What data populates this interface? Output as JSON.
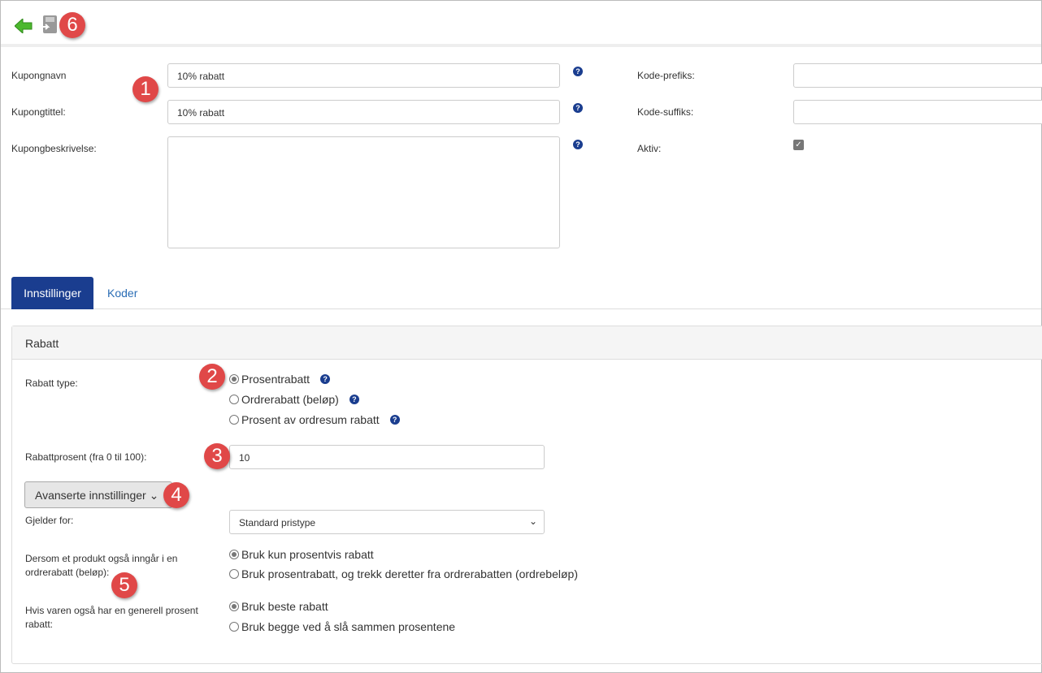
{
  "toolbar": {
    "back_icon": "green-arrow-left-icon",
    "save_icon": "save-disk-icon"
  },
  "badges": [
    "1",
    "2",
    "3",
    "4",
    "5",
    "6"
  ],
  "form": {
    "name_label": "Kupongnavn",
    "name_value": "10% rabatt",
    "title_label": "Kupongtittel:",
    "title_value": "10% rabatt",
    "desc_label": "Kupongbeskrivelse:",
    "desc_value": "",
    "prefix_label": "Kode-prefiks:",
    "prefix_value": "",
    "suffix_label": "Kode-suffiks:",
    "suffix_value": "",
    "active_label": "Aktiv:",
    "active_checked": true,
    "help": "?"
  },
  "tabs": [
    {
      "label": "Innstillinger",
      "active": true
    },
    {
      "label": "Koder",
      "active": false
    }
  ],
  "panel": {
    "title": "Rabatt",
    "type_label": "Rabatt type:",
    "type_options": [
      {
        "label": "Prosentrabatt",
        "checked": true
      },
      {
        "label": "Ordrerabatt (beløp)",
        "checked": false
      },
      {
        "label": "Prosent av ordresum rabatt",
        "checked": false
      }
    ],
    "percent_label": "Rabattprosent (fra 0 til 100):",
    "percent_value": "10",
    "advanced_button": "Avanserte innstillinger",
    "applies_label": "Gjelder for:",
    "applies_value": "Standard pristype",
    "order_label": "Dersom et produkt også inngår i en ordrerabatt (beløp):",
    "order_options": [
      {
        "label": "Bruk kun prosentvis rabatt",
        "checked": true
      },
      {
        "label": "Bruk prosentrabatt, og trekk deretter fra ordrerabatten (ordrebeløp)",
        "checked": false
      }
    ],
    "general_label": "Hvis varen også har en generell prosent rabatt:",
    "general_options": [
      {
        "label": "Bruk beste rabatt",
        "checked": true
      },
      {
        "label": "Bruk begge ved å slå sammen prosentene",
        "checked": false
      }
    ]
  },
  "colors": {
    "tab_active": "#1a3d8f",
    "badge": "#e04848",
    "link": "#2a6db5"
  }
}
